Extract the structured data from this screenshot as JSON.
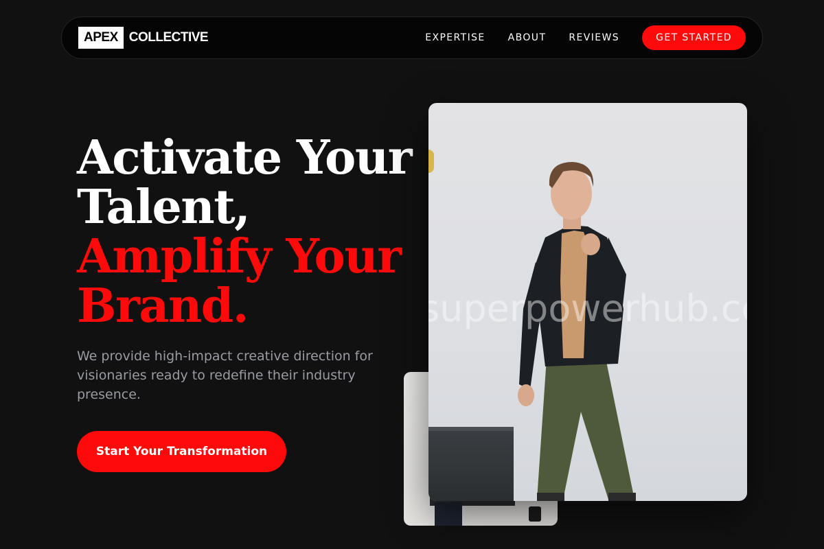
{
  "nav": {
    "logo_box": "APEX",
    "logo_text": "COLLECTIVE",
    "links": [
      {
        "label": "EXPERTISE"
      },
      {
        "label": "ABOUT"
      },
      {
        "label": "REVIEWS"
      }
    ],
    "cta_label": "GET STARTED"
  },
  "hero": {
    "title_line1": "Activate Your",
    "title_line2": "Talent,",
    "title_line3": "Amplify Your",
    "title_line4": "Brand.",
    "description": "We provide high-impact creative direction for visionaries ready to redefine their industry presence.",
    "cta_label": "Start Your Transformation"
  },
  "images": {
    "watermark": "superpowerhub.com"
  },
  "colors": {
    "background": "#111111",
    "accent": "#ff0a0a",
    "text_muted": "#9a9ca3"
  }
}
